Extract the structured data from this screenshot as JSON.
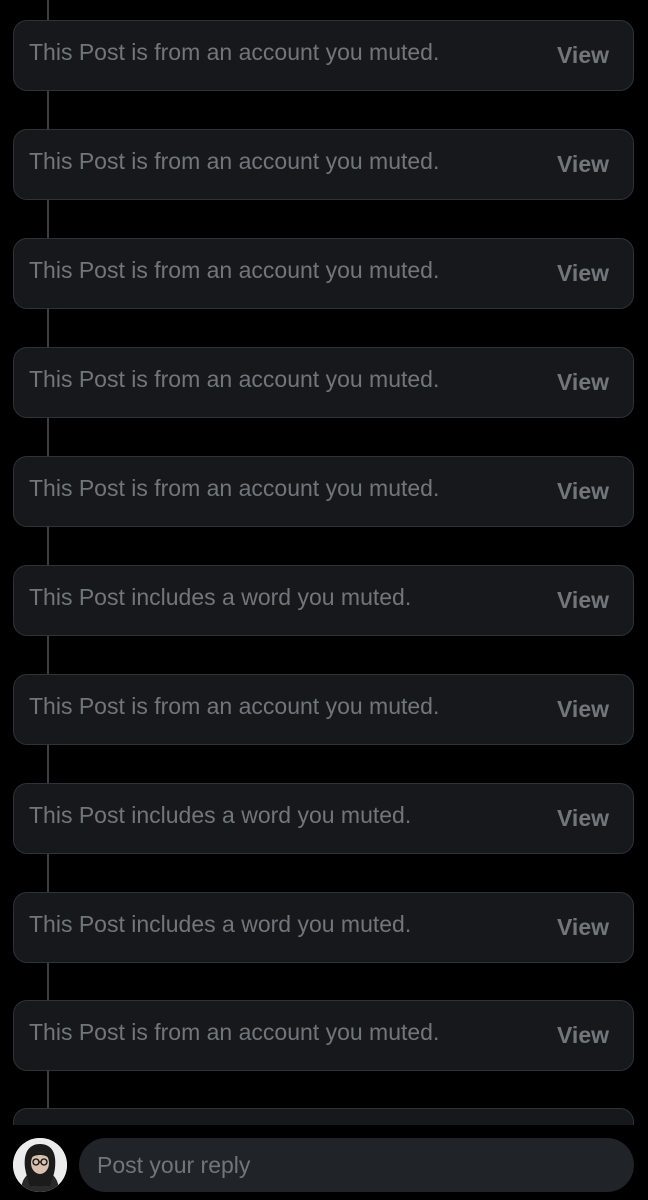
{
  "muted_posts": [
    {
      "message": "This Post is from an account you muted.",
      "action_label": "View"
    },
    {
      "message": "This Post is from an account you muted.",
      "action_label": "View"
    },
    {
      "message": "This Post is from an account you muted.",
      "action_label": "View"
    },
    {
      "message": "This Post is from an account you muted.",
      "action_label": "View"
    },
    {
      "message": "This Post is from an account you muted.",
      "action_label": "View"
    },
    {
      "message": "This Post includes a word you muted.",
      "action_label": "View"
    },
    {
      "message": "This Post is from an account you muted.",
      "action_label": "View"
    },
    {
      "message": "This Post includes a word you muted.",
      "action_label": "View"
    },
    {
      "message": "This Post includes a word you muted.",
      "action_label": "View"
    },
    {
      "message": "This Post is from an account you muted.",
      "action_label": "View"
    }
  ],
  "reply_bar": {
    "placeholder": "Post your reply",
    "value": "",
    "avatar_icon": "user-avatar-icon"
  },
  "colors": {
    "background": "#000000",
    "card_background": "#17181c",
    "card_border": "#2f3336",
    "muted_text": "#71767b",
    "thread_line": "#3b3f45",
    "input_background": "#202327"
  }
}
